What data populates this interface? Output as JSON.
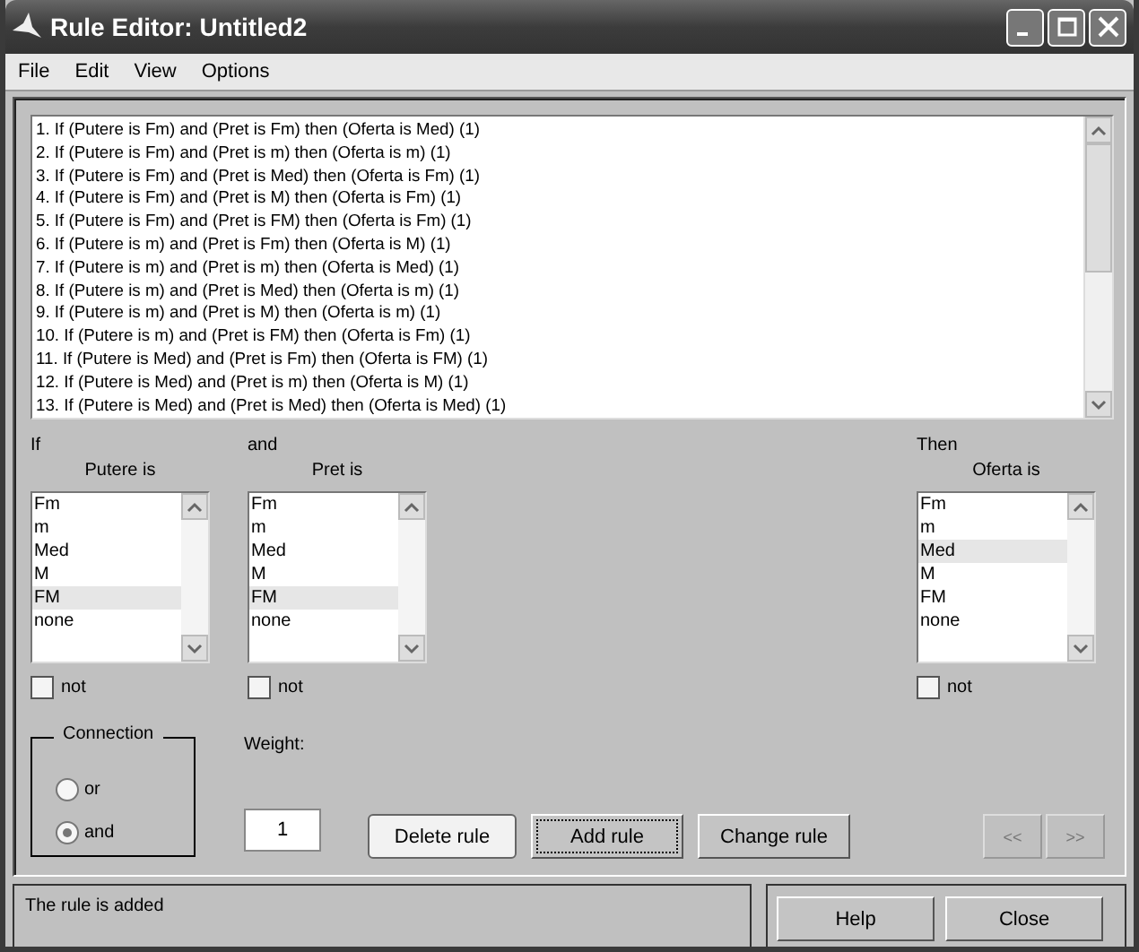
{
  "window": {
    "title": "Rule Editor: Untitled2"
  },
  "menu": [
    "File",
    "Edit",
    "View",
    "Options"
  ],
  "rules": [
    "1. If (Putere is Fm) and (Pret is Fm) then (Oferta is Med) (1)",
    "2. If (Putere is Fm) and (Pret is m) then (Oferta is m) (1)",
    "3. If (Putere is Fm) and (Pret is Med) then (Oferta is Fm) (1)",
    "4. If (Putere is Fm) and (Pret is M) then (Oferta is Fm) (1)",
    "5. If (Putere is Fm) and (Pret is FM) then (Oferta is Fm) (1)",
    "6. If (Putere is m) and (Pret is Fm) then (Oferta is M) (1)",
    "7. If (Putere is m) and (Pret is m) then (Oferta is Med) (1)",
    "8. If (Putere is m) and (Pret is Med) then (Oferta is m) (1)",
    "9. If (Putere is m) and (Pret is M) then (Oferta is m) (1)",
    "10. If (Putere is m) and (Pret is FM) then (Oferta is Fm) (1)",
    "11. If (Putere is Med) and (Pret is Fm) then (Oferta is FM) (1)",
    "12. If (Putere is Med) and (Pret is m) then (Oferta is M) (1)",
    "13. If (Putere is Med) and (Pret is Med) then (Oferta is Med) (1)"
  ],
  "variables": [
    {
      "kind": "input",
      "prefix": "If",
      "label": "Putere is",
      "not_label": "not",
      "not_checked": false,
      "options": [
        {
          "label": "Fm",
          "selected": false
        },
        {
          "label": "m",
          "selected": false
        },
        {
          "label": "Med",
          "selected": false
        },
        {
          "label": "M",
          "selected": false
        },
        {
          "label": "FM",
          "selected": true
        },
        {
          "label": "none",
          "selected": false
        }
      ]
    },
    {
      "kind": "input",
      "prefix": "and",
      "label": "Pret is",
      "not_label": "not",
      "not_checked": false,
      "options": [
        {
          "label": "Fm",
          "selected": false
        },
        {
          "label": "m",
          "selected": false
        },
        {
          "label": "Med",
          "selected": false
        },
        {
          "label": "M",
          "selected": false
        },
        {
          "label": "FM",
          "selected": true
        },
        {
          "label": "none",
          "selected": false
        }
      ]
    },
    {
      "kind": "output",
      "prefix": "Then",
      "label": "Oferta is",
      "not_label": "not",
      "not_checked": false,
      "options": [
        {
          "label": "Fm",
          "selected": false
        },
        {
          "label": "m",
          "selected": false
        },
        {
          "label": "Med",
          "selected": true
        },
        {
          "label": "M",
          "selected": false
        },
        {
          "label": "FM",
          "selected": false
        },
        {
          "label": "none",
          "selected": false
        }
      ]
    }
  ],
  "connection": {
    "title": "Connection",
    "options": [
      {
        "label": "or",
        "selected": false
      },
      {
        "label": "and",
        "selected": true
      }
    ]
  },
  "weight": {
    "label": "Weight:",
    "value": "1"
  },
  "buttons": [
    {
      "label": "Delete rule",
      "focused": false,
      "disabled": false
    },
    {
      "label": "Add rule",
      "focused": true,
      "disabled": false
    },
    {
      "label": "Change rule",
      "focused": false,
      "disabled": false
    }
  ],
  "nav_buttons": [
    {
      "label": "<<",
      "disabled": true
    },
    {
      "label": ">>",
      "disabled": true
    }
  ],
  "status": "The rule is added",
  "footer_buttons": [
    "Help",
    "Close"
  ]
}
